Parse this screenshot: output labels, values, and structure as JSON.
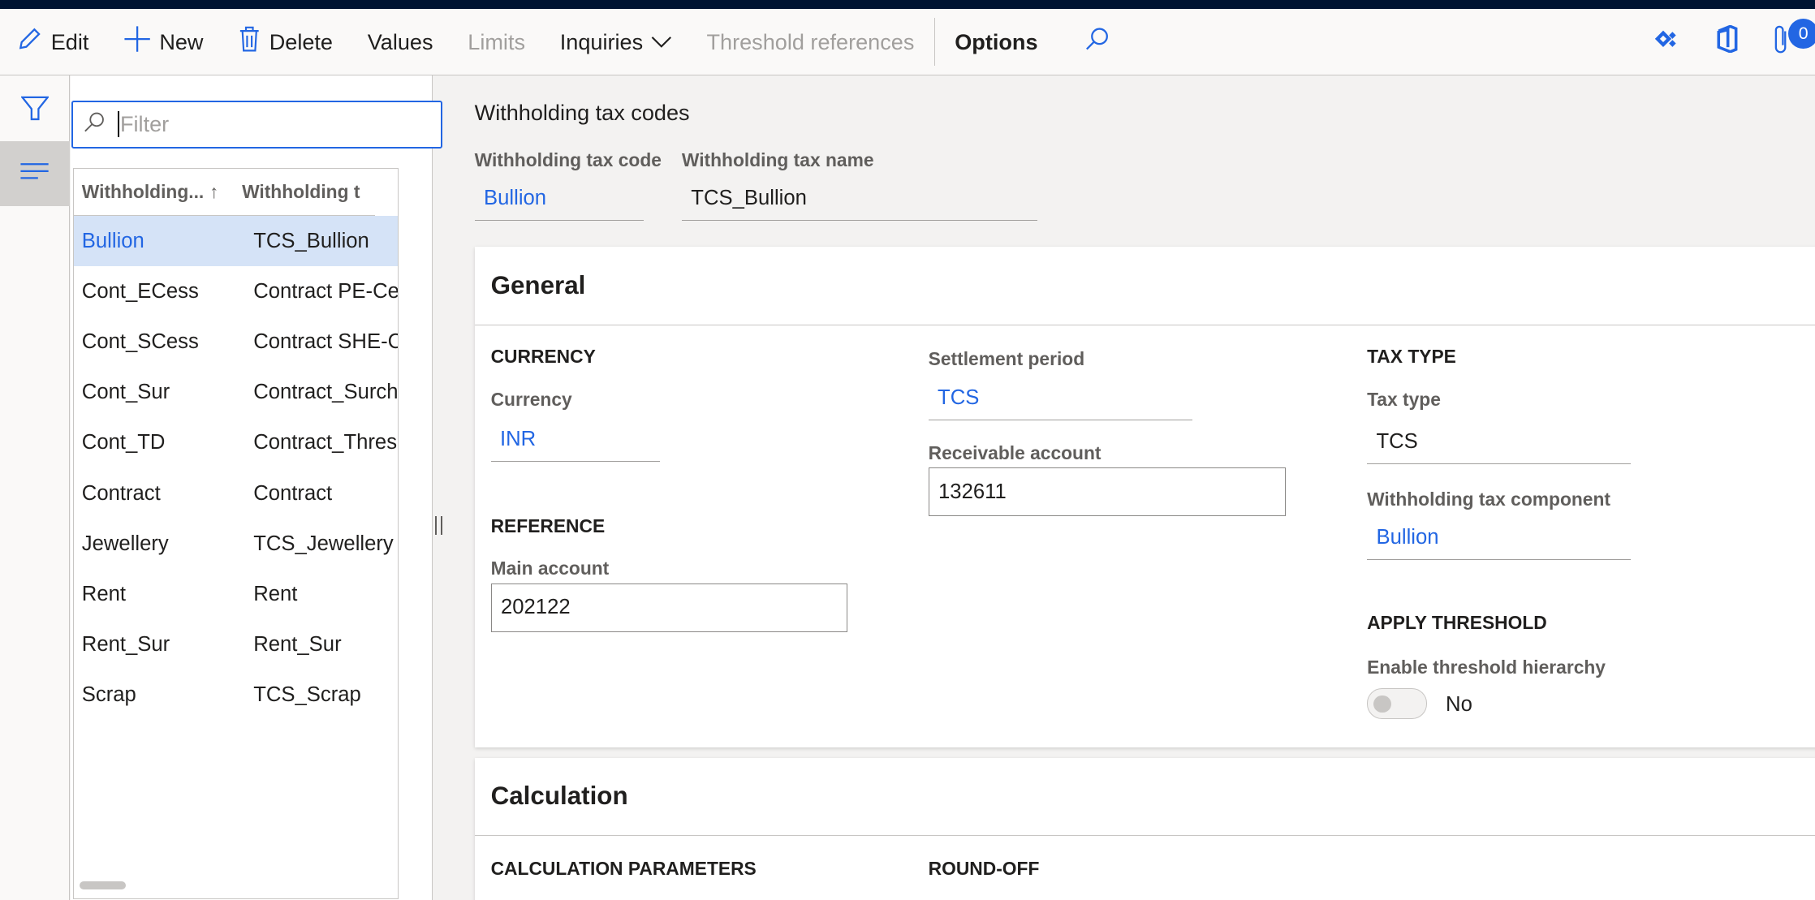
{
  "toolbar": {
    "edit": "Edit",
    "new": "New",
    "delete": "Delete",
    "values": "Values",
    "limits": "Limits",
    "inquiries": "Inquiries",
    "threshold_references": "Threshold references",
    "options": "Options",
    "attachments_count": "0"
  },
  "list": {
    "filter_placeholder": "Filter",
    "columns": [
      "Withholding...",
      "Withholding t"
    ],
    "rows": [
      [
        "Bullion",
        "TCS_Bullion"
      ],
      [
        "Cont_ECess",
        "Contract PE-Cess"
      ],
      [
        "Cont_SCess",
        "Contract SHE-Cess"
      ],
      [
        "Cont_Sur",
        "Contract_Surcharge"
      ],
      [
        "Cont_TD",
        "Contract_Threshold"
      ],
      [
        "Contract",
        "Contract"
      ],
      [
        "Jewellery",
        "TCS_Jewellery"
      ],
      [
        "Rent",
        "Rent"
      ],
      [
        "Rent_Sur",
        "Rent_Sur"
      ],
      [
        "Scrap",
        "TCS_Scrap"
      ]
    ]
  },
  "main": {
    "title": "Withholding tax codes",
    "code_label": "Withholding tax code",
    "code_value": "Bullion",
    "name_label": "Withholding tax name",
    "name_value": "TCS_Bullion"
  },
  "general": {
    "title": "General",
    "currency_section": "CURRENCY",
    "currency_label": "Currency",
    "currency_value": "INR",
    "reference_section": "REFERENCE",
    "main_account_label": "Main account",
    "main_account_value": "202122",
    "settlement_label": "Settlement period",
    "settlement_value": "TCS",
    "receivable_label": "Receivable account",
    "receivable_value": "132611",
    "tax_type_section": "TAX TYPE",
    "tax_type_label": "Tax type",
    "tax_type_value": "TCS",
    "component_label": "Withholding tax component",
    "component_value": "Bullion",
    "threshold_section": "APPLY THRESHOLD",
    "hierarchy_label": "Enable threshold hierarchy",
    "hierarchy_value": "No",
    "hierarchy_enabled": false
  },
  "calculation": {
    "title": "Calculation",
    "params_section": "CALCULATION PARAMETERS",
    "roundoff_section": "ROUND-OFF"
  }
}
